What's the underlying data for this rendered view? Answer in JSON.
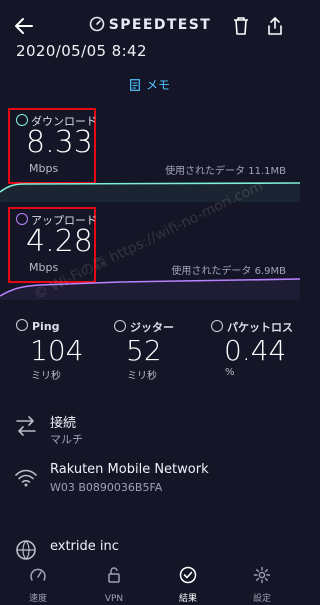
{
  "header": {
    "brand": "SPEEDTEST"
  },
  "datetime": "2020/05/05 8:42",
  "memo_label": "メモ",
  "download": {
    "label": "ダウンロード",
    "value": "8.33",
    "unit": "Mbps",
    "used_text": "使用されたデータ 11.1MB"
  },
  "upload": {
    "label": "アップロード",
    "value": "4.28",
    "unit": "Mbps",
    "used_text": "使用されたデータ 6.9MB"
  },
  "stats": {
    "ping": {
      "label": "Ping",
      "value": "104",
      "unit": "ミリ秒"
    },
    "jitter": {
      "label": "ジッター",
      "value": "52",
      "unit": "ミリ秒"
    },
    "loss": {
      "label": "パケットロス",
      "value": "0.44",
      "unit": "%"
    }
  },
  "connection": {
    "title": "接続",
    "subtitle": "マルチ"
  },
  "provider": {
    "title": "Rakuten Mobile Network",
    "subtitle": "W03  B0890036B5FA"
  },
  "server": {
    "title": "extride inc"
  },
  "watermark": "© Wi-Fiの森  https://wifi-no-mori.com",
  "nav": [
    {
      "label": "速度",
      "icon": "speed-gauge-icon"
    },
    {
      "label": "VPN",
      "icon": "lock-icon"
    },
    {
      "label": "結果",
      "icon": "check-circle-icon"
    },
    {
      "label": "設定",
      "icon": "gear-icon"
    }
  ],
  "colors": {
    "background": "#141526",
    "download_graph": "#7ef0da",
    "upload_graph": "#b884ff",
    "memo": "#4ec7ff",
    "highlight_box": "#e50914"
  }
}
